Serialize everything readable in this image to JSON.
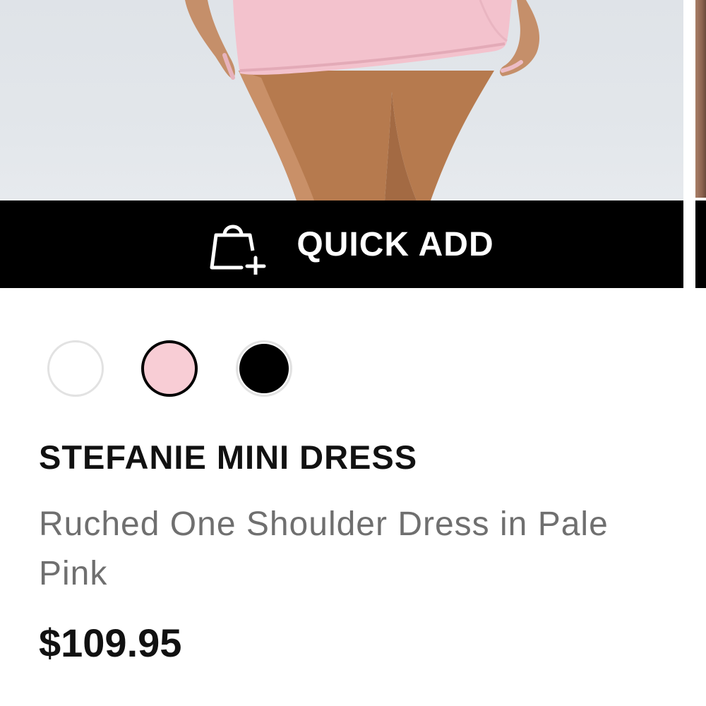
{
  "product": {
    "image_alt": "Model wearing pale pink mini dress",
    "quick_add_label": "QUICK ADD",
    "name": "STEFANIE MINI DRESS",
    "description": "Ruched One Shoulder Dress in Pale Pink",
    "price": "$109.95",
    "swatches": [
      {
        "color_name": "white",
        "hex": "#ffffff",
        "selected": false
      },
      {
        "color_name": "pale pink",
        "hex": "#f8cdd5",
        "selected": true
      },
      {
        "color_name": "black",
        "hex": "#000000",
        "selected": false
      }
    ]
  },
  "icons": {
    "quick_add": "shopping-bag-plus-icon"
  },
  "colors": {
    "quick_add_bg": "#000000",
    "quick_add_text": "#ffffff",
    "name_text": "#111111",
    "description_text": "#6f6f6f",
    "price_text": "#111111"
  }
}
